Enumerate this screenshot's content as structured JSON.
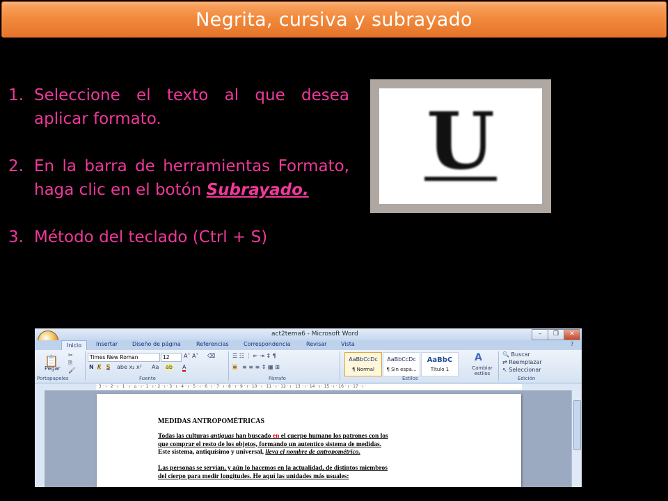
{
  "slide": {
    "title": "Negrita, cursiva y subrayado",
    "steps": [
      {
        "num": "1.",
        "text": "Seleccione el texto al que desea aplicar formato."
      },
      {
        "num": "2.",
        "text": "En la barra de herramientas Formato, haga clic en el botón ",
        "emphasis": "Subrayado."
      },
      {
        "num": "3.",
        "text": "Método del teclado (Ctrl + S)"
      }
    ],
    "underline_icon_letter": "U"
  },
  "word": {
    "window_title": "act2tema6 - Microsoft Word",
    "tabs": [
      "Inicio",
      "Insertar",
      "Diseño de página",
      "Referencias",
      "Correspondencia",
      "Revisar",
      "Vista"
    ],
    "font_name": "Times New Roman",
    "font_size": "12",
    "groups": {
      "clipboard": "Portapapeles",
      "font": "Fuente",
      "paragraph": "Párrafo",
      "styles": "Estilos",
      "editing": "Edición"
    },
    "paste_label": "Pegar",
    "styles": [
      {
        "preview": "AaBbCcDc",
        "name": "¶ Normal"
      },
      {
        "preview": "AaBbCcDc",
        "name": "¶ Sin espa..."
      },
      {
        "preview": "AaBbC",
        "name": "Título 1"
      }
    ],
    "change_styles": "Cambiar estilos",
    "editing_items": [
      "Buscar",
      "Reemplazar",
      "Seleccionar"
    ],
    "doc": {
      "heading": "MEDIDAS ANTROPOMÉTRICAS",
      "p1_a": "Todas las culturas ",
      "p1_b": "antiguas",
      "p1_c": " han buscado ",
      "p1_d": "en",
      "p1_e": " el cuerpo humano los patrones con los",
      "p1_line2": "que comprar el resto de los objetos, formando un autentico sistema de medidas.",
      "p1_line3_a": "Este sistema,  antiquísimo  y universal, ",
      "p1_line3_b": "lleva el nombre de antropométrico.",
      "p2_line1": "Las personas se servían, y aún lo hacemos en la actualidad, de distintos miembros",
      "p2_line2": "del cierpo para medir longitudes. He aquí las unidades más usuales:"
    }
  },
  "colors": {
    "title_bg": "#f28a3c",
    "step_text": "#f0389a"
  }
}
